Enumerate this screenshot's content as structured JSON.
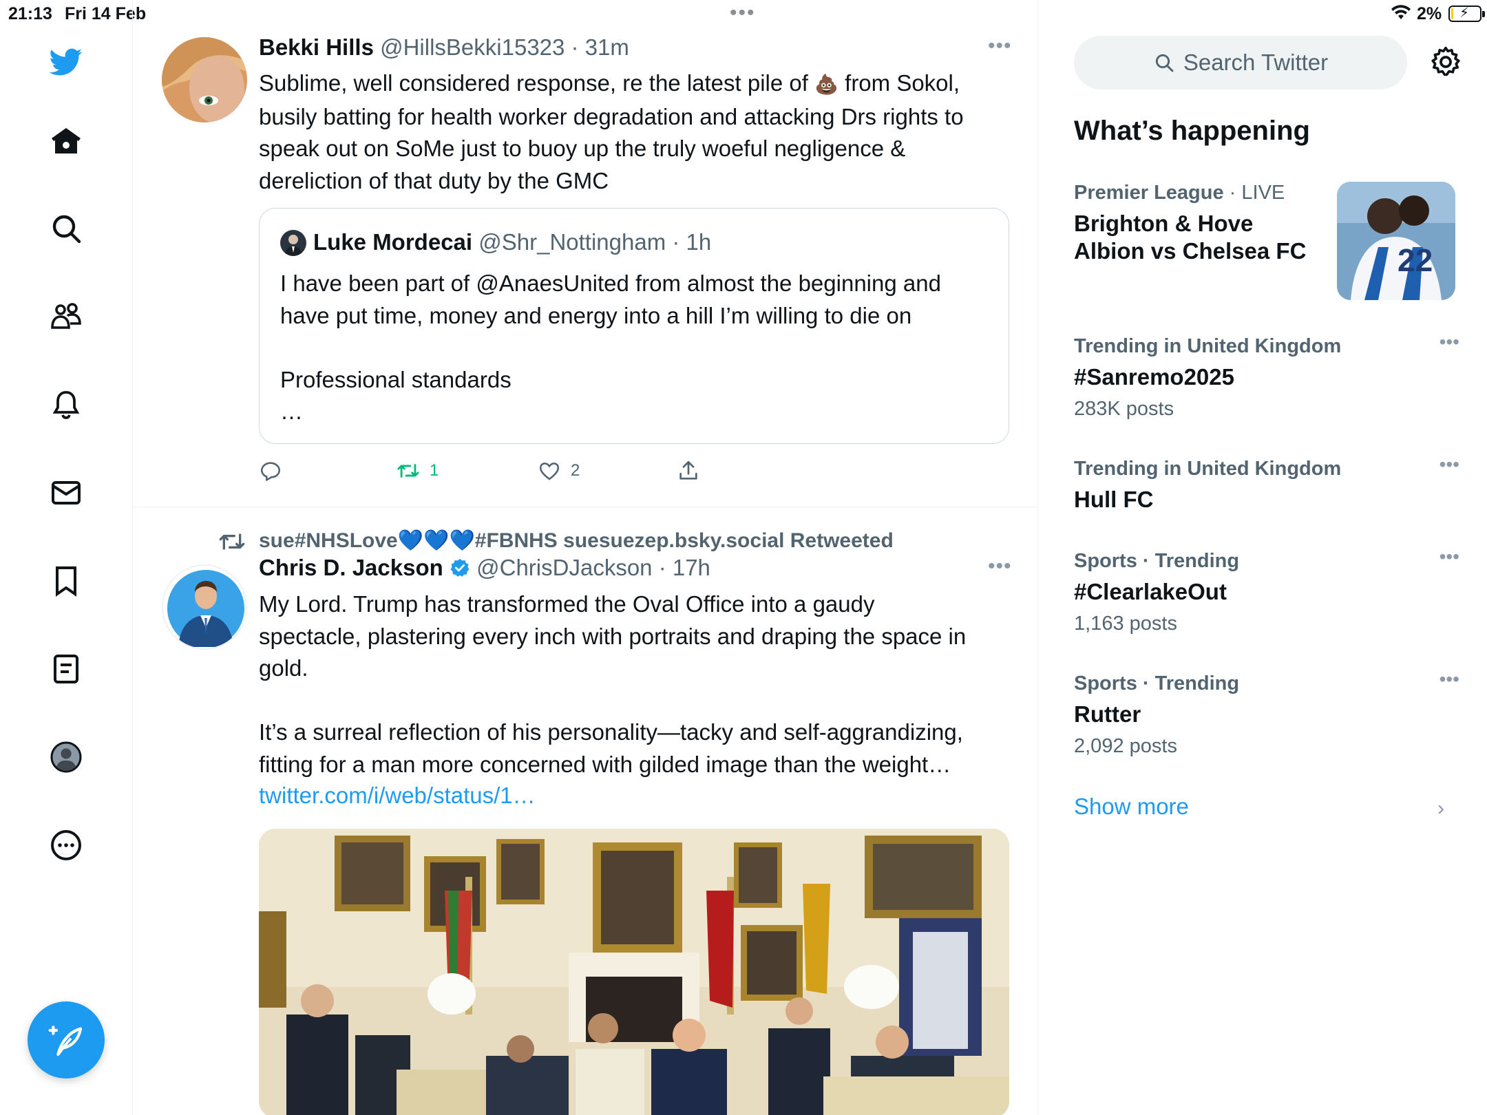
{
  "status_bar": {
    "time": "21:13",
    "date": "Fri 14 Feb",
    "battery": "2%",
    "multitask_dots": "•••"
  },
  "nav": {
    "icons": [
      "twitter-logo",
      "home-icon",
      "search-icon",
      "communities-icon",
      "notifications-icon",
      "messages-icon",
      "bookmarks-icon",
      "lists-icon",
      "profile-icon",
      "more-icon"
    ],
    "compose_label": "compose"
  },
  "tweets": [
    {
      "name": "Bekki Hills",
      "handle": "@HillsBekki15323 · 31m",
      "text_before_emoji": "Sublime, well considered response, re the latest pile of ",
      "emoji": "💩",
      "text_after_emoji": " from Sokol,\nbusily batting for health worker degradation and attacking Drs rights to\nspeak out on SoMe just to buoy up the truly woeful negligence &\ndereliction of that duty by the GMC",
      "quote": {
        "name": "Luke Mordecai",
        "handle": "@Shr_Nottingham · 1h",
        "text": "I have been part of @AnaesUnited from almost the beginning and\nhave put time, money and energy into a hill I’m willing to die on\n\nProfessional standards\n…"
      },
      "retweets": "1",
      "likes": "2"
    },
    {
      "retweeted_by": "sue#NHSLove💙💙💙#FBNHS suesuezep.bsky.social Retweeted",
      "name": "Chris D. Jackson",
      "handle": "@ChrisDJackson · 17h",
      "text": "My Lord. Trump has transformed the Oval Office into a gaudy\nspectacle, plastering every inch with portraits and draping the space in\ngold.\n\nIt’s a surreal reflection of his personality—tacky and self-aggrandizing,\nfitting for a man more concerned with gilded image than the weight…",
      "link": "twitter.com/i/web/status/1…"
    }
  ],
  "sidebar": {
    "search_placeholder": "Search Twitter",
    "section_title": "What’s happening",
    "trends": [
      {
        "meta": "Premier League",
        "meta_light": " · LIVE",
        "topic": "Brighton & Hove\nAlbion vs Chelsea FC",
        "count": ""
      },
      {
        "meta": "Trending in United Kingdom",
        "meta_light": "",
        "topic": "#Sanremo2025",
        "count": "283K posts"
      },
      {
        "meta": "Trending in United Kingdom",
        "meta_light": "",
        "topic": "Hull FC",
        "count": ""
      },
      {
        "meta": "Sports · Trending",
        "meta_light": "",
        "topic": "#ClearlakeOut",
        "count": "1,163 posts"
      },
      {
        "meta": "Sports · Trending",
        "meta_light": "",
        "topic": "Rutter",
        "count": "2,092 posts"
      }
    ],
    "show_more": "Show more"
  },
  "colors": {
    "accent": "#1d9bf0",
    "retweet_green": "#00ba7c",
    "text": "#0f1419",
    "muted": "#536471"
  }
}
